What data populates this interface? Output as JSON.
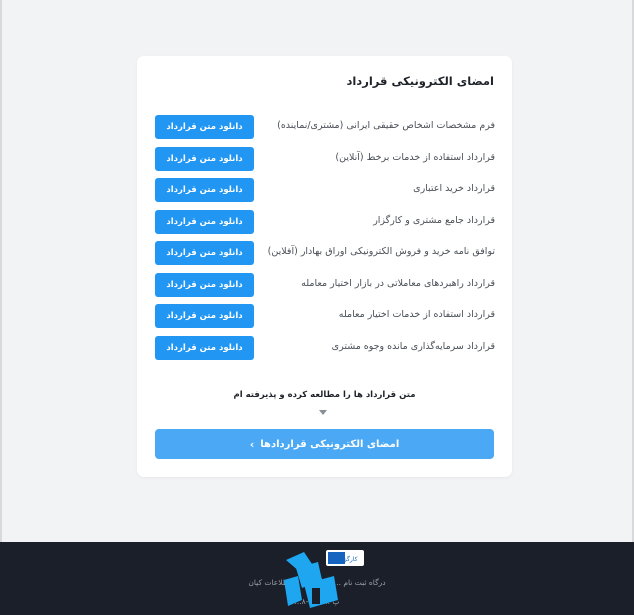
{
  "card": {
    "title": "امضای الکترونیکی قرارداد",
    "download_label": "دانلود متن قرارداد",
    "contracts": [
      "فرم مشخصات اشخاص حقیقی ایرانی (مشتری/نماینده)",
      "قرارداد استفاده از خدمات برخط (آنلاین)",
      "قرارداد خرید اعتباری",
      "قرارداد جامع مشتری و کارگزار",
      "توافق نامه خرید و فروش الکترونیکی اوراق بهادار (آفلاین)",
      "قرارداد راهبردهای معاملاتی در بازار اختیار معامله",
      "قرارداد استفاده از خدمات اختیار معامله",
      "قرارداد سرمایه‌گذاری مانده وجوه مشتری"
    ],
    "accept_text": "متن قرارداد ها را مطالعه کرده و پذیرفته ام",
    "sign_button": "امضای الکترونیکی قراردادها",
    "sign_chevron": "›"
  },
  "footer": {
    "logo_text": "کارگزاری",
    "line1": "درگاه ثبت نام ... کارگزاری ... اطلاعات کیان",
    "line2": "پ ... ۰۲۱-۸..."
  },
  "colors": {
    "primary": "#2196f3",
    "sign_button": "#4aa8f5",
    "footer_bg": "#1a1f29",
    "page_bg": "#f2f3f5"
  }
}
